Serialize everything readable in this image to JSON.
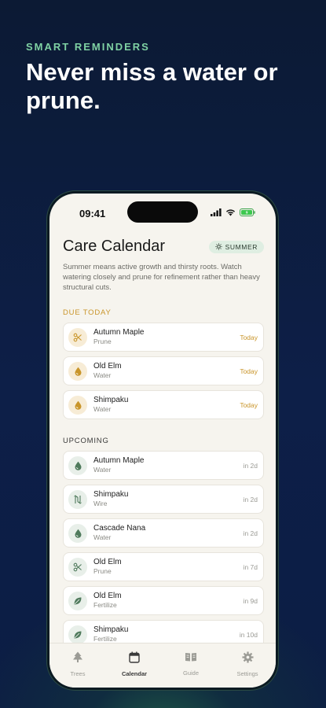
{
  "promo": {
    "eyebrow": "SMART REMINDERS",
    "headline": "Never miss a water or prune."
  },
  "status_bar": {
    "time": "09:41"
  },
  "header": {
    "title": "Care Calendar",
    "season_badge": "SUMMER",
    "description": "Summer means active growth and thirsty roots. Watch watering closely and prune for refinement rather than heavy structural cuts."
  },
  "due_today": {
    "label": "DUE TODAY",
    "items": [
      {
        "tree": "Autumn Maple",
        "task": "Prune",
        "when": "Today",
        "icon": "scissors-icon"
      },
      {
        "tree": "Old Elm",
        "task": "Water",
        "when": "Today",
        "icon": "water-drop-icon"
      },
      {
        "tree": "Shimpaku",
        "task": "Water",
        "when": "Today",
        "icon": "water-drop-icon"
      }
    ]
  },
  "upcoming": {
    "label": "UPCOMING",
    "items": [
      {
        "tree": "Autumn Maple",
        "task": "Water",
        "when": "in 2d",
        "icon": "water-drop-icon"
      },
      {
        "tree": "Shimpaku",
        "task": "Wire",
        "when": "in 2d",
        "icon": "wire-icon"
      },
      {
        "tree": "Cascade Nana",
        "task": "Water",
        "when": "in 2d",
        "icon": "water-drop-icon"
      },
      {
        "tree": "Old Elm",
        "task": "Prune",
        "when": "in 7d",
        "icon": "scissors-icon"
      },
      {
        "tree": "Old Elm",
        "task": "Fertilize",
        "when": "in 9d",
        "icon": "leaf-icon"
      },
      {
        "tree": "Shimpaku",
        "task": "Fertilize",
        "when": "in 10d",
        "icon": "leaf-icon"
      }
    ]
  },
  "tabs": [
    {
      "label": "Trees",
      "icon": "tree-icon",
      "active": false
    },
    {
      "label": "Calendar",
      "icon": "calendar-icon",
      "active": true
    },
    {
      "label": "Guide",
      "icon": "book-icon",
      "active": false
    },
    {
      "label": "Settings",
      "icon": "gear-icon",
      "active": false
    }
  ],
  "colors": {
    "accent_amber": "#c9952a",
    "accent_green": "#4f7a5c",
    "headline_eyebrow": "#7fd1a3"
  }
}
